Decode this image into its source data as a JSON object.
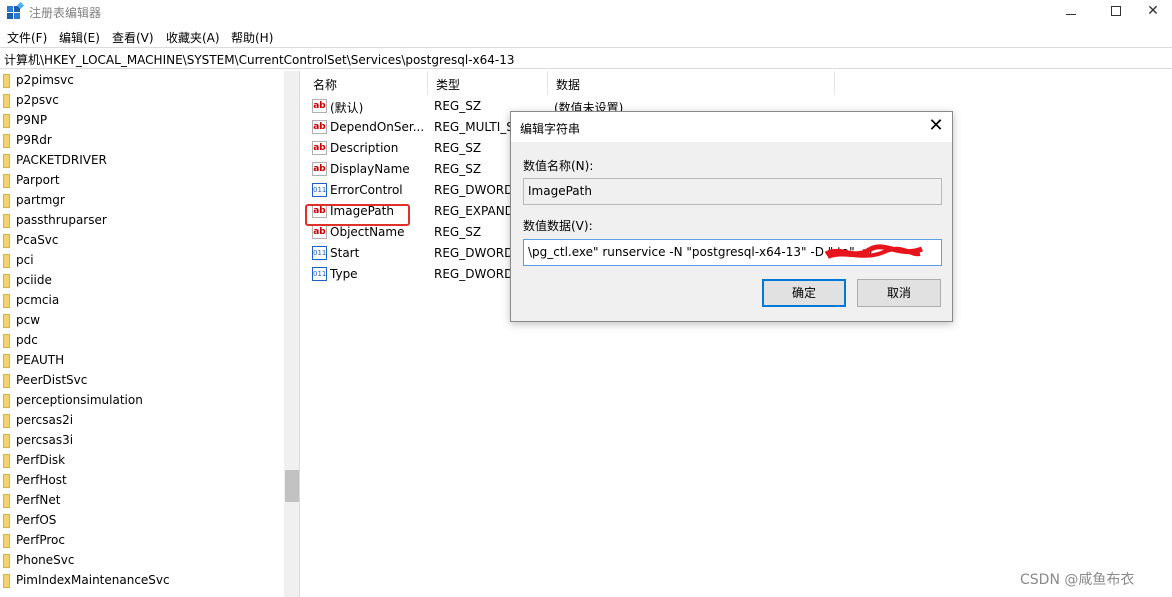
{
  "window": {
    "title": "注册表编辑器"
  },
  "menu": [
    "文件(F)",
    "编辑(E)",
    "查看(V)",
    "收藏夹(A)",
    "帮助(H)"
  ],
  "address": "计算机\\HKEY_LOCAL_MACHINE\\SYSTEM\\CurrentControlSet\\Services\\postgresql-x64-13",
  "tree": {
    "items": [
      "p2pimsvc",
      "p2psvc",
      "P9NP",
      "P9Rdr",
      "PACKETDRIVER",
      "Parport",
      "partmgr",
      "passthruparser",
      "PcaSvc",
      "pci",
      "pciide",
      "pcmcia",
      "pcw",
      "pdc",
      "PEAUTH",
      "PeerDistSvc",
      "perceptionsimulation",
      "percsas2i",
      "percsas3i",
      "PerfDisk",
      "PerfHost",
      "PerfNet",
      "PerfOS",
      "PerfProc",
      "PhoneSvc",
      "PimIndexMaintenanceSvc"
    ]
  },
  "values": {
    "columns": [
      "名称",
      "类型",
      "数据"
    ],
    "rows": [
      {
        "icon": "string-value-icon",
        "name": "(默认)",
        "type": "REG_SZ",
        "data": "(数值未设置)"
      },
      {
        "icon": "string-value-icon",
        "name": "DependOnSer...",
        "type": "REG_MULTI_S",
        "data": ""
      },
      {
        "icon": "string-value-icon",
        "name": "Description",
        "type": "REG_SZ",
        "data": ""
      },
      {
        "icon": "string-value-icon",
        "name": "DisplayName",
        "type": "REG_SZ",
        "data": ""
      },
      {
        "icon": "binary-value-icon",
        "name": "ErrorControl",
        "type": "REG_DWORD",
        "data": ""
      },
      {
        "icon": "string-value-icon",
        "name": "ImagePath",
        "type": "REG_EXPAND",
        "data": ""
      },
      {
        "icon": "string-value-icon",
        "name": "ObjectName",
        "type": "REG_SZ",
        "data": ""
      },
      {
        "icon": "binary-value-icon",
        "name": "Start",
        "type": "REG_DWORD",
        "data": ""
      },
      {
        "icon": "binary-value-icon",
        "name": "Type",
        "type": "REG_DWORD",
        "data": ""
      }
    ],
    "highlighted": "ImagePath"
  },
  "dialog": {
    "title": "编辑字符串",
    "name_label": "数值名称(N):",
    "name_value": "ImagePath",
    "data_label": "数值数据(V):",
    "data_value": "\\pg_ctl.exe\" runservice -N \"postgresql-x64-13\" -D \"                    ta\" -w",
    "ok_label": "确定",
    "cancel_label": "取消"
  },
  "watermark": "CSDN @咸鱼布衣",
  "colors": {
    "highlight_border": "#e0302a",
    "accent": "#0078d7",
    "folder": "#f3d36c"
  }
}
